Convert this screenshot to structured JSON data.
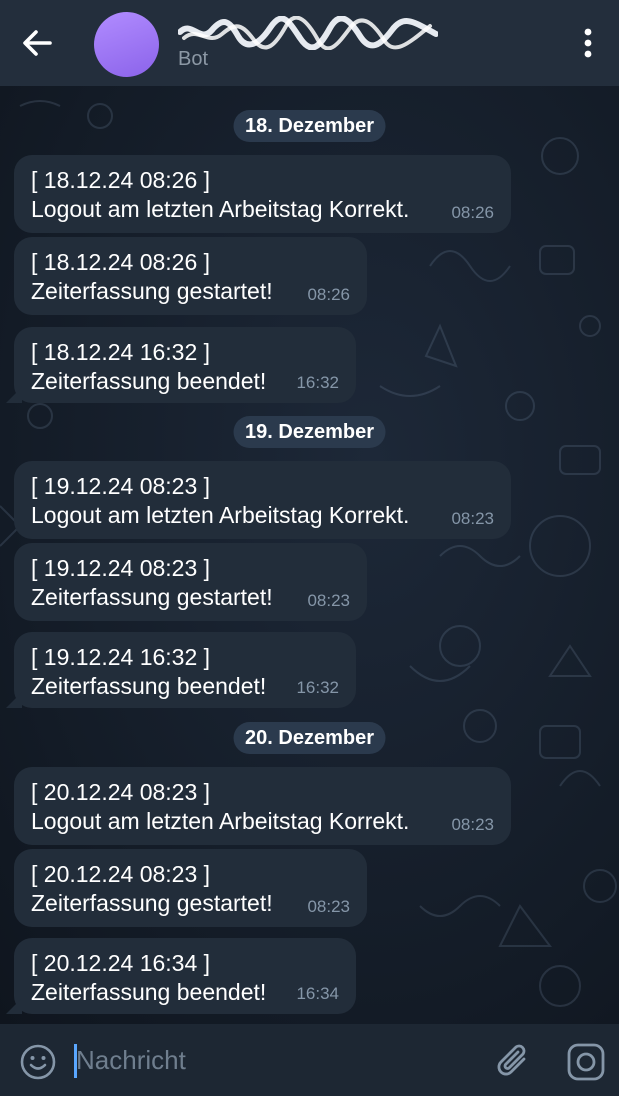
{
  "header": {
    "back_icon": "arrow-left-icon",
    "title": "",
    "subtitle": "Bot",
    "menu_icon": "more-vertical-icon",
    "avatar_color": "#9b74f4"
  },
  "messages": [
    {
      "date": "18. Dezember"
    },
    {
      "line1": "[ 18.12.24  08:26 ]",
      "line2": "Logout am letzten Arbeitstag Korrekt.",
      "time": "08:26"
    },
    {
      "line1": "[ 18.12.24  08:26 ]",
      "line2": "Zeiterfassung gestartet!",
      "time": "08:26"
    },
    {
      "line1": "[ 18.12.24  16:32 ]",
      "line2": "Zeiterfassung beendet!",
      "time": "16:32"
    },
    {
      "date": "19. Dezember"
    },
    {
      "line1": "[ 19.12.24  08:23 ]",
      "line2": "Logout am letzten Arbeitstag Korrekt.",
      "time": "08:23"
    },
    {
      "line1": "[ 19.12.24  08:23 ]",
      "line2": "Zeiterfassung gestartet!",
      "time": "08:23"
    },
    {
      "line1": "[ 19.12.24  16:32 ]",
      "line2": "Zeiterfassung beendet!",
      "time": "16:32"
    },
    {
      "date": "20. Dezember"
    },
    {
      "line1": "[ 20.12.24  08:23 ]",
      "line2": "Logout am letzten Arbeitstag Korrekt.",
      "time": "08:23"
    },
    {
      "line1": "[ 20.12.24  08:23 ]",
      "line2": "Zeiterfassung gestartet!",
      "time": "08:23"
    },
    {
      "line1": "[ 20.12.24  16:34 ]",
      "line2": "Zeiterfassung beendet!",
      "time": "16:34"
    }
  ],
  "input": {
    "placeholder": "Nachricht",
    "emoji_icon": "emoji-icon",
    "attach_icon": "paperclip-icon",
    "camera_icon": "instagram-camera-icon"
  },
  "colors": {
    "header_bg": "#232e3c",
    "bubble_bg": "#222d3a",
    "date_pill_bg": "#2b3a4d",
    "accent": "#5aa7ff"
  }
}
